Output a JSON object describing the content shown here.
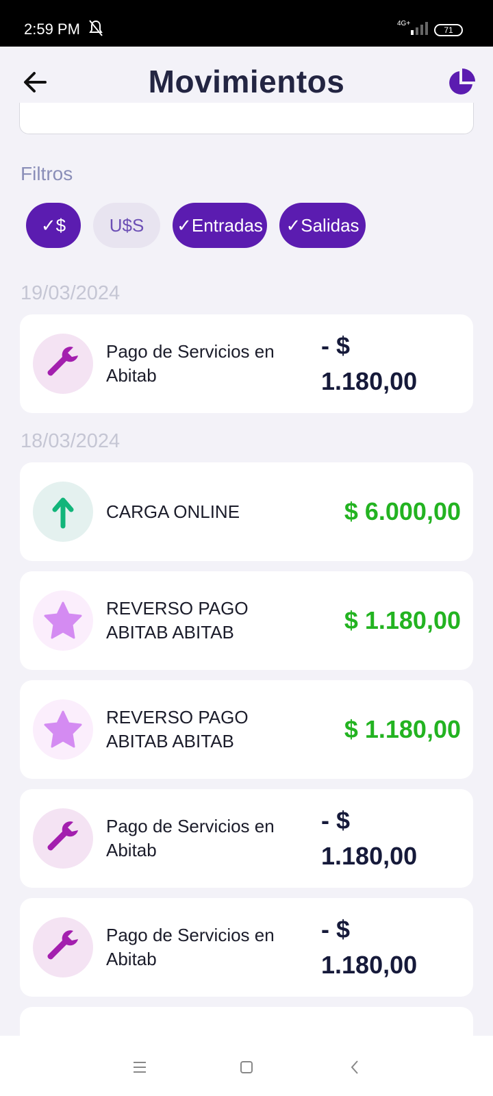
{
  "status_bar": {
    "time": "2:59 PM",
    "network": "4G+",
    "battery": "71"
  },
  "header": {
    "title": "Movimientos",
    "back_icon": "arrow-left-icon",
    "action_icon": "pie-chart-icon"
  },
  "filters": {
    "label": "Filtros",
    "chips": [
      {
        "label": "✓$",
        "selected": true
      },
      {
        "label": "U$S",
        "selected": false
      },
      {
        "label": "✓Entradas",
        "selected": true
      },
      {
        "label": "✓Salidas",
        "selected": true
      }
    ]
  },
  "groups": [
    {
      "date": "19/03/2024",
      "transactions": [
        {
          "icon": "wrench-icon",
          "description": "Pago de Servicios en Abitab",
          "amount": "- $ 1.180,00",
          "amount_line1": "- $",
          "amount_line2": "1.180,00",
          "type": "negative"
        }
      ]
    },
    {
      "date": "18/03/2024",
      "transactions": [
        {
          "icon": "arrow-up-icon",
          "description": "CARGA ONLINE",
          "amount": "$ 6.000,00",
          "type": "positive"
        },
        {
          "icon": "star-icon",
          "description": "REVERSO PAGO ABITAB ABITAB",
          "amount": "$ 1.180,00",
          "type": "positive"
        },
        {
          "icon": "star-icon",
          "description": "REVERSO PAGO ABITAB ABITAB",
          "amount": "$ 1.180,00",
          "type": "positive"
        },
        {
          "icon": "wrench-icon",
          "description": "Pago de Servicios en Abitab",
          "amount": "- $ 1.180,00",
          "amount_line1": "- $",
          "amount_line2": "1.180,00",
          "type": "negative"
        },
        {
          "icon": "wrench-icon",
          "description": "Pago de Servicios en Abitab",
          "amount": "- $ 1.180,00",
          "amount_line1": "- $",
          "amount_line2": "1.180,00",
          "type": "negative"
        }
      ]
    }
  ],
  "colors": {
    "accent": "#5b1cb0",
    "positive": "#23b321",
    "negative": "#161a3a",
    "wrench": "#a31fae",
    "star": "#d48bf2",
    "arrow": "#12b57a"
  },
  "nav_bar": {
    "items": [
      "menu-icon",
      "home-icon",
      "back-icon"
    ]
  }
}
